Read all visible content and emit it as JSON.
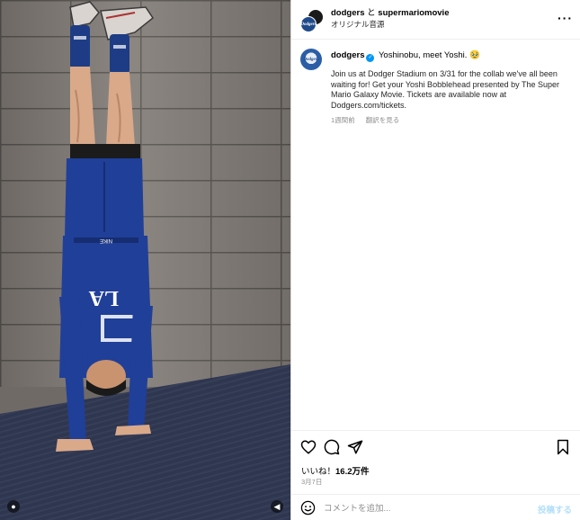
{
  "header": {
    "account_a": "dodgers",
    "connector": "と",
    "account_b": "supermariomovie",
    "audio": "オリジナル音源",
    "more_icon": "more-horizontal-icon"
  },
  "caption": {
    "username": "dodgers",
    "headline": "Yoshinobu, meet Yoshi. 🥹",
    "body": "Join us at Dodger Stadium on 3/31 for the collab we've all been waiting for! Get your Yoshi Bobblehead presented by The Super Mario Galaxy Movie. Tickets are available now at Dodgers.com/tickets.",
    "time_ago": "1週間前",
    "translate": "翻訳を見る",
    "avatar_text": "Dodgers"
  },
  "jersey": {
    "front_text": "LA",
    "brand_text": "NIKE"
  },
  "actions": {
    "icons": [
      "heart-icon",
      "comment-icon",
      "share-icon",
      "bookmark-icon"
    ],
    "likes_prefix": "いいね！",
    "likes_count": "16.2万件",
    "date": "3月7日"
  },
  "comment": {
    "placeholder": "コメントを追加...",
    "post_label": "投稿する",
    "emoji_icon": "smiley-icon"
  },
  "colors": {
    "brand_blue": "#1e4a8a",
    "verified_blue": "#0095f6",
    "link_blue_disabled": "#b2dffc",
    "muted_text": "#8e8e8e"
  }
}
